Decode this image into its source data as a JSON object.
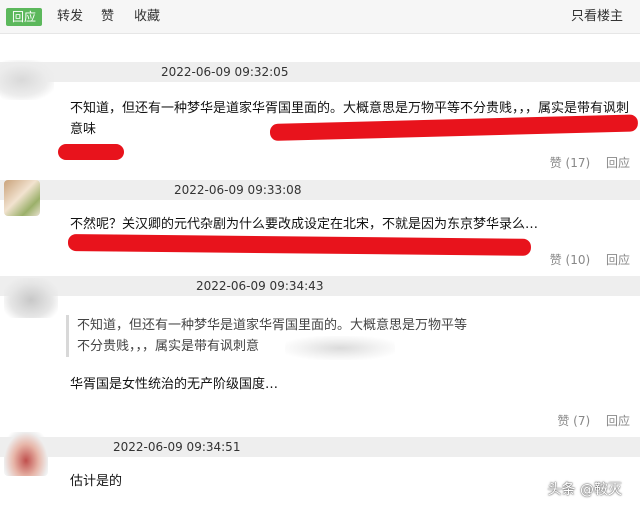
{
  "toolbar": {
    "reply_label": "回应",
    "forward_label": "转发",
    "like_label": "赞",
    "favorite_label": "收藏",
    "only_op_label": "只看楼主"
  },
  "posts": [
    {
      "timestamp": "2022-06-09 09:32:05",
      "text": "不知道，但还有一种梦华是道家华胥国里面的。大概意思是万物平等不分贵贱，，，属实是带有讽刺意味",
      "like_label": "赞 (17)",
      "reply_label": "回应"
    },
    {
      "timestamp": "2022-06-09 09:33:08",
      "text": "不然呢？关汉卿的元代杂剧为什么要改成设定在北宋，不就是因为东京梦华录么…",
      "like_label": "赞 (10)",
      "reply_label": "回应"
    },
    {
      "timestamp": "2022-06-09 09:34:43",
      "quote_line1": "不知道，但还有一种梦华是道家华胥国里面的。大概意思是万物平等",
      "quote_line2": "不分贵贱，，，属实是带有讽刺意",
      "text": "华胥国是女性统治的无产阶级国度…",
      "like_label": "赞 (7)",
      "reply_label": "回应"
    },
    {
      "timestamp": "2022-06-09 09:34:51",
      "text": "估计是的"
    }
  ],
  "watermark": "头条 @鞍灭",
  "colors": {
    "accent": "#5cb85c",
    "redact": "#e8131c"
  }
}
